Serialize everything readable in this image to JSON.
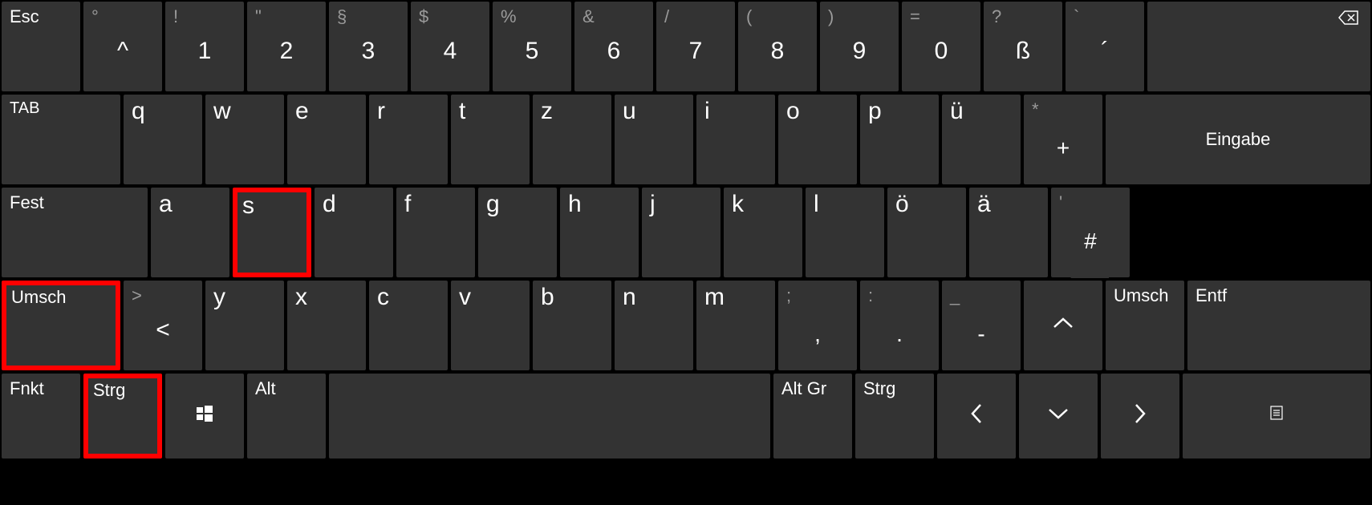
{
  "row1": {
    "esc": "Esc",
    "keys": [
      {
        "shift": "°",
        "main": "^"
      },
      {
        "shift": "!",
        "main": "1"
      },
      {
        "shift": "\"",
        "main": "2"
      },
      {
        "shift": "§",
        "main": "3"
      },
      {
        "shift": "$",
        "main": "4"
      },
      {
        "shift": "%",
        "main": "5"
      },
      {
        "shift": "&",
        "main": "6"
      },
      {
        "shift": "/",
        "main": "7"
      },
      {
        "shift": "(",
        "main": "8"
      },
      {
        "shift": ")",
        "main": "9"
      },
      {
        "shift": "=",
        "main": "0"
      },
      {
        "shift": "?",
        "main": "ß"
      },
      {
        "shift": "`",
        "main": "´"
      }
    ]
  },
  "row2": {
    "tab": "TAB",
    "letters": [
      "q",
      "w",
      "e",
      "r",
      "t",
      "z",
      "u",
      "i",
      "o",
      "p",
      "ü"
    ],
    "plus": {
      "shift": "*",
      "main": "+"
    },
    "enter": "Eingabe"
  },
  "row3": {
    "caps": "Fest",
    "letters": [
      "a",
      "s",
      "d",
      "f",
      "g",
      "h",
      "j",
      "k",
      "l",
      "ö",
      "ä"
    ],
    "hash": {
      "shift": "'",
      "main": "#"
    }
  },
  "row4": {
    "shift_left": "Umsch",
    "angle": {
      "shift": ">",
      "main": "<"
    },
    "letters": [
      "y",
      "x",
      "c",
      "v",
      "b",
      "n",
      "m"
    ],
    "comma": {
      "shift": ";",
      "main": ","
    },
    "period": {
      "shift": ":",
      "main": "."
    },
    "dash": {
      "shift": "_",
      "main": "-"
    },
    "shift_right": "Umsch",
    "del": "Entf"
  },
  "row5": {
    "fn": "Fnkt",
    "ctrl_left": "Strg",
    "alt_left": "Alt",
    "altgr": "Alt Gr",
    "ctrl_right": "Strg"
  }
}
